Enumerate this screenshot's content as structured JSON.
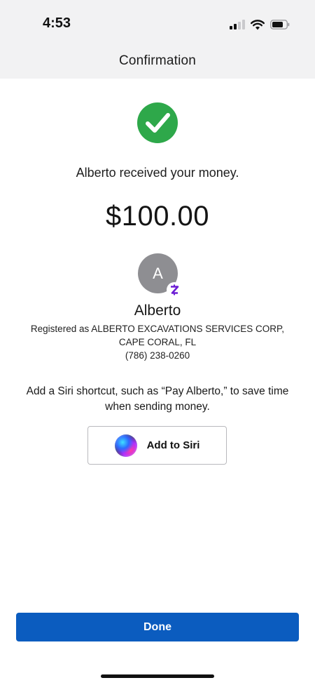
{
  "status_bar": {
    "time": "4:53"
  },
  "header": {
    "title": "Confirmation"
  },
  "confirmation": {
    "message": "Alberto received your money.",
    "amount": "$100.00"
  },
  "recipient": {
    "initial": "A",
    "name": "Alberto",
    "registered_line1": "Registered as ALBERTO EXCAVATIONS SERVICES CORP,",
    "registered_line2": "CAPE CORAL, FL",
    "phone": "(786) 238-0260"
  },
  "siri": {
    "description_line1": "Add a Siri shortcut, such as “Pay Alberto,” to save time",
    "description_line2": "when sending money.",
    "button_label": "Add to Siri"
  },
  "footer": {
    "done_label": "Done"
  },
  "colors": {
    "success_green": "#2ea84a",
    "primary_blue": "#0b5cbf",
    "zelle_purple": "#6d1ed4",
    "avatar_gray": "#8e8e92"
  }
}
